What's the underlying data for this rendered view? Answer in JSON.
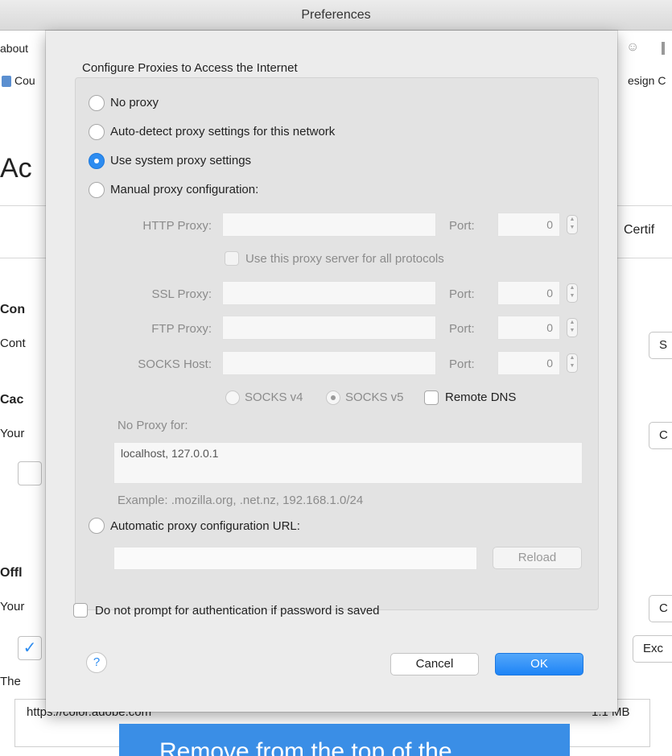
{
  "window": {
    "title": "Preferences"
  },
  "background": {
    "left_fragments": [
      "about",
      "Cou",
      "Ac",
      "Con",
      "Cont",
      "Cac",
      "Your",
      "Offl",
      "Your",
      "The"
    ],
    "right_fragments": [
      "esign C",
      "Certif"
    ],
    "button_fragments": [
      "S",
      "C",
      "C",
      "Exc"
    ],
    "site_url": "https://color.adobe.com",
    "site_size": "1.1 MB",
    "banner_text": "Remove from the top of the"
  },
  "dialog": {
    "heading": "Configure Proxies to Access the Internet",
    "options": {
      "no_proxy": "No proxy",
      "auto_detect": "Auto-detect proxy settings for this network",
      "system": "Use system proxy settings",
      "manual": "Manual proxy configuration:",
      "auto_url": "Automatic proxy configuration URL:"
    },
    "selected_option": "system",
    "manual": {
      "http_label": "HTTP Proxy:",
      "ssl_label": "SSL Proxy:",
      "ftp_label": "FTP Proxy:",
      "socks_label": "SOCKS Host:",
      "port_label": "Port:",
      "http_port": "0",
      "ssl_port": "0",
      "ftp_port": "0",
      "socks_port": "0",
      "use_all_label": "Use this proxy server for all protocols",
      "socks_v4": "SOCKS v4",
      "socks_v5": "SOCKS v5",
      "remote_dns": "Remote DNS"
    },
    "no_proxy_label": "No Proxy for:",
    "no_proxy_value": "localhost, 127.0.0.1",
    "example_text": "Example: .mozilla.org, .net.nz, 192.168.1.0/24",
    "reload_label": "Reload",
    "auth_prompt_label": "Do not prompt for authentication if password is saved",
    "help_label": "?",
    "cancel_label": "Cancel",
    "ok_label": "OK"
  }
}
